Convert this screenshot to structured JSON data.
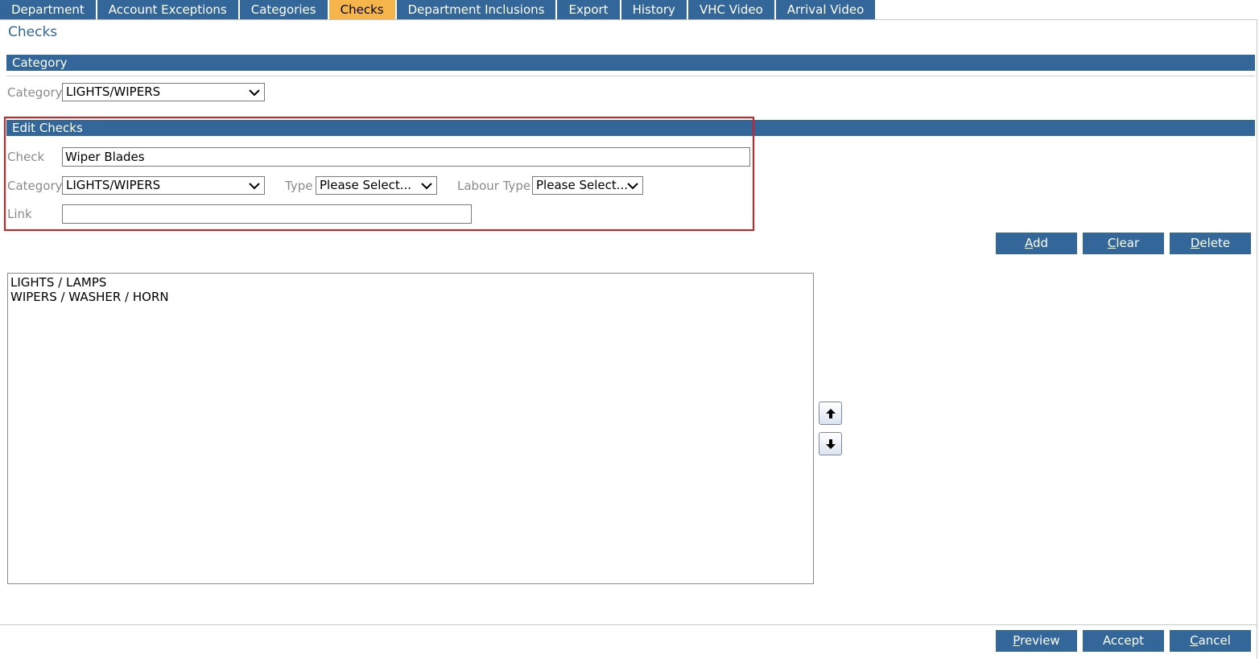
{
  "tabs": [
    {
      "label": "Department"
    },
    {
      "label": "Account Exceptions"
    },
    {
      "label": "Categories"
    },
    {
      "label": "Checks",
      "active": true
    },
    {
      "label": "Department Inclusions"
    },
    {
      "label": "Export"
    },
    {
      "label": "History"
    },
    {
      "label": "VHC Video"
    },
    {
      "label": "Arrival Video"
    }
  ],
  "page": {
    "title": "Checks"
  },
  "category_section": {
    "header": "Category",
    "category_label": "Category",
    "category_value": "LIGHTS/WIPERS"
  },
  "edit_section": {
    "header": "Edit Checks",
    "check_label": "Check",
    "check_value": "Wiper Blades",
    "category_label": "Category",
    "category_value": "LIGHTS/WIPERS",
    "type_label": "Type",
    "type_value": "Please Select...",
    "labour_label": "Labour Type",
    "labour_value": "Please Select...",
    "link_label": "Link",
    "link_value": ""
  },
  "actions": {
    "add_first": "A",
    "add_rest": "dd",
    "clear_first": "C",
    "clear_rest": "lear",
    "delete_first": "D",
    "delete_rest": "elete"
  },
  "list": {
    "items": [
      "LIGHTS / LAMPS",
      "WIPERS / WASHER / HORN"
    ]
  },
  "icons": {
    "up": "arrow-up-icon",
    "down": "arrow-down-icon",
    "dropdown": "chevron-down-icon"
  },
  "footer": {
    "preview_first": "P",
    "preview_rest": "review",
    "accept_label": "Accept",
    "cancel_first": "C",
    "cancel_rest": "ancel"
  },
  "colors": {
    "accent": "#336699",
    "active_tab": "#f6b54b",
    "highlight": "#e01b1b"
  }
}
